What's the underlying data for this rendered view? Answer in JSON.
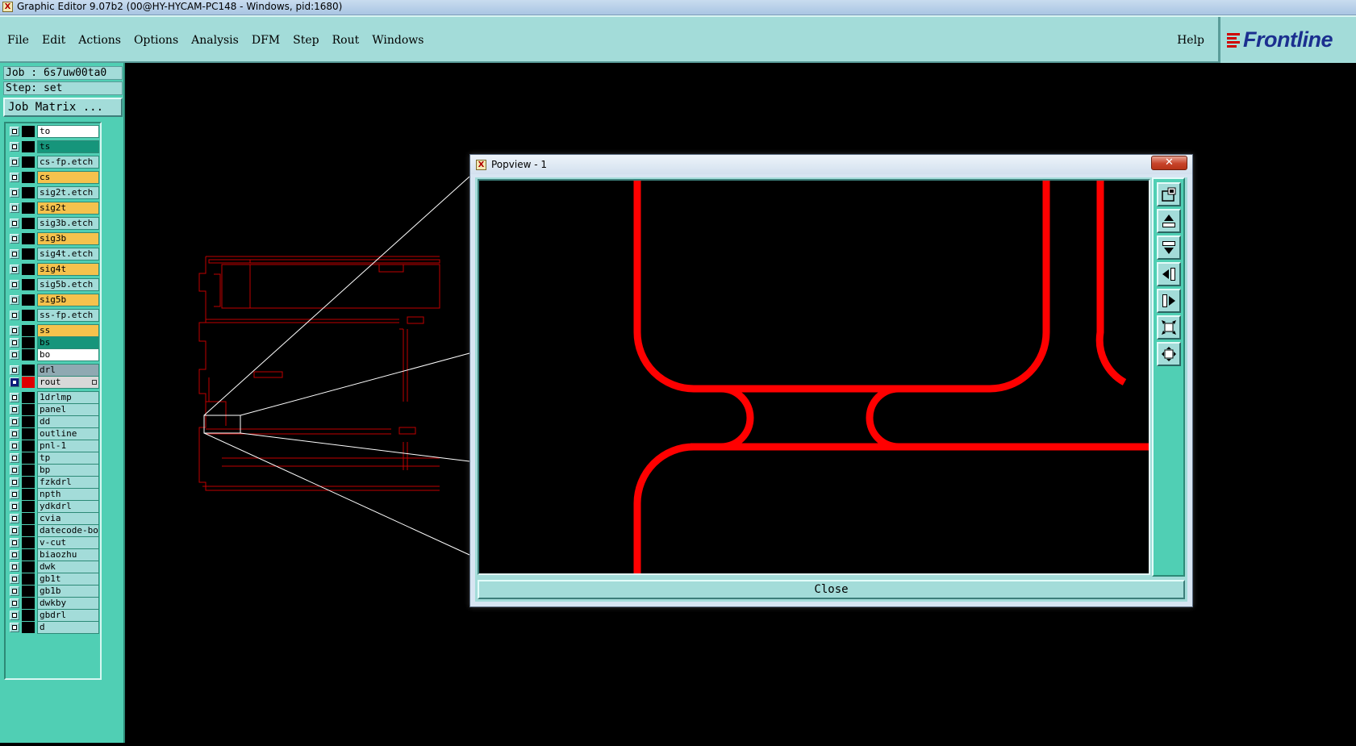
{
  "os_window": {
    "title": "Graphic Editor 9.07b2 (00@HY-HYCAM-PC148 - Windows, pid:1680)"
  },
  "menu": {
    "items": [
      "File",
      "Edit",
      "Actions",
      "Options",
      "Analysis",
      "DFM",
      "Step",
      "Rout",
      "Windows"
    ],
    "help": "Help",
    "logo": "Frontline"
  },
  "job": {
    "job_label": "Job : 6s7uw00ta0",
    "step_label": "Step: set",
    "matrix_button": "Job Matrix ..."
  },
  "layers": [
    {
      "name": "to",
      "color": "#ffffff"
    },
    {
      "name": "ts",
      "color": "#16957b"
    },
    {
      "name": "cs-fp.etch",
      "color": "#a3dcd9"
    },
    {
      "name": "cs",
      "color": "#f5c24d"
    },
    {
      "name": "sig2t.etch",
      "color": "#a3dcd9"
    },
    {
      "name": "sig2t",
      "color": "#f5c24d"
    },
    {
      "name": "sig3b.etch",
      "color": "#a3dcd9"
    },
    {
      "name": "sig3b",
      "color": "#f5c24d"
    },
    {
      "name": "sig4t.etch",
      "color": "#a3dcd9"
    },
    {
      "name": "sig4t",
      "color": "#f5c24d"
    },
    {
      "name": "sig5b.etch",
      "color": "#a3dcd9"
    },
    {
      "name": "sig5b",
      "color": "#f5c24d"
    },
    {
      "name": "ss-fp.etch",
      "color": "#a3dcd9"
    },
    {
      "name": "ss",
      "color": "#f5c24d"
    },
    {
      "name": "bs",
      "color": "#16957b"
    },
    {
      "name": "bo",
      "color": "#ffffff"
    },
    {
      "name": "drl",
      "color": "#8fa9b2"
    },
    {
      "name": "rout",
      "color": "#d8d8d8",
      "active": true
    },
    {
      "name": "1drlmp",
      "color": "#a3dcd9"
    },
    {
      "name": "panel",
      "color": "#a3dcd9"
    },
    {
      "name": "dd",
      "color": "#a3dcd9"
    },
    {
      "name": "outline",
      "color": "#a3dcd9"
    },
    {
      "name": "pnl-1",
      "color": "#a3dcd9"
    },
    {
      "name": "tp",
      "color": "#a3dcd9"
    },
    {
      "name": "bp",
      "color": "#a3dcd9"
    },
    {
      "name": "fzkdrl",
      "color": "#a3dcd9"
    },
    {
      "name": "npth",
      "color": "#a3dcd9"
    },
    {
      "name": "ydkdrl",
      "color": "#a3dcd9"
    },
    {
      "name": "cvia",
      "color": "#a3dcd9"
    },
    {
      "name": "datecode-bo",
      "color": "#a3dcd9"
    },
    {
      "name": "v-cut",
      "color": "#a3dcd9"
    },
    {
      "name": "biaozhu",
      "color": "#a3dcd9"
    },
    {
      "name": "dwk",
      "color": "#a3dcd9"
    },
    {
      "name": "gb1t",
      "color": "#a3dcd9"
    },
    {
      "name": "gb1b",
      "color": "#a3dcd9"
    },
    {
      "name": "dwkby",
      "color": "#a3dcd9"
    },
    {
      "name": "gbdrl",
      "color": "#a3dcd9"
    },
    {
      "name": "d",
      "color": "#a3dcd9"
    }
  ],
  "popview": {
    "title": "Popview - 1",
    "close_button": "Close",
    "tools": [
      "zoom-to-window-icon",
      "move-up-icon",
      "move-down-icon",
      "move-left-icon",
      "move-right-icon",
      "zoom-out-icon",
      "zoom-in-icon"
    ]
  },
  "colors": {
    "panel": "#50cfb4",
    "button": "#a3dcd9",
    "rout_line": "#ff0000",
    "outline": "#c00000"
  }
}
